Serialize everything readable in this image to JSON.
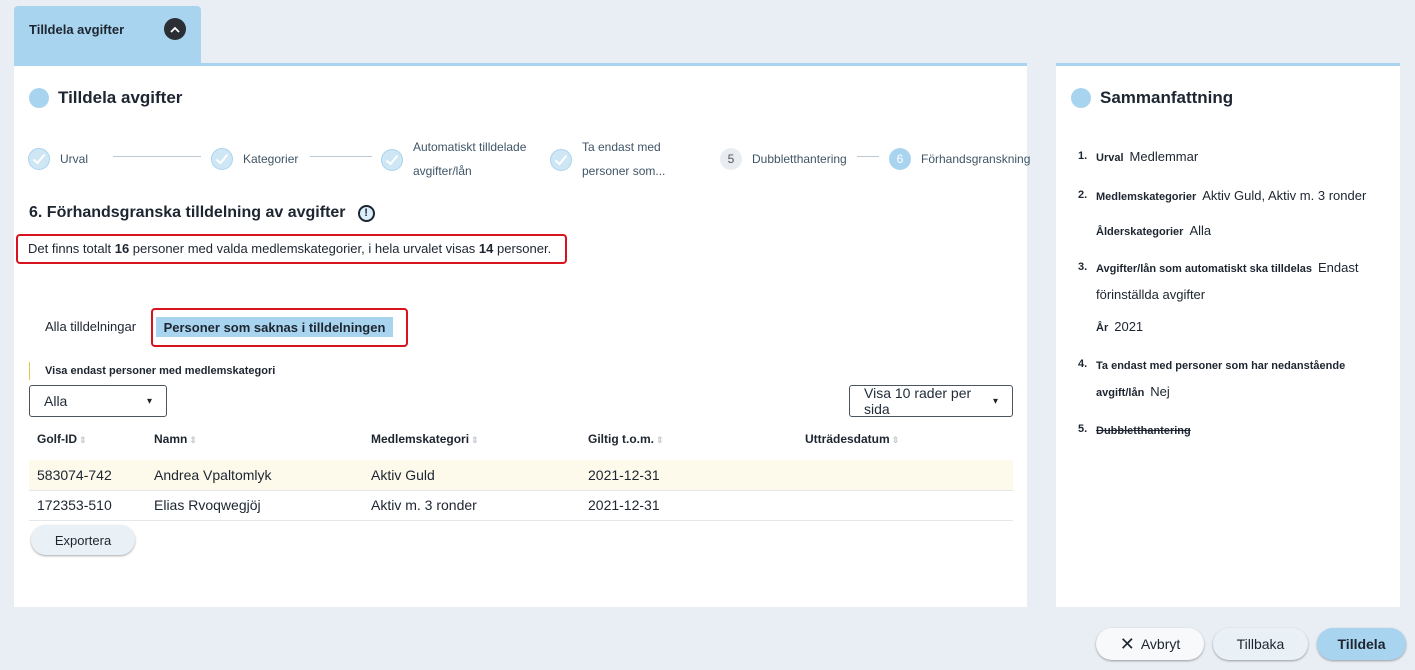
{
  "top_tab": {
    "label": "Tilldela avgifter"
  },
  "main": {
    "title": "Tilldela avgifter",
    "steps": [
      {
        "label": "Urval",
        "state": "done"
      },
      {
        "label": "Kategorier",
        "state": "done"
      },
      {
        "label_line1": "Automatiskt tilldelade",
        "label_line2": "avgifter/lån",
        "state": "done"
      },
      {
        "label_line1": "Ta endast med",
        "label_line2": "personer som...",
        "state": "done"
      },
      {
        "number": "5",
        "label": "Dubbletthantering",
        "state": "pending"
      },
      {
        "number": "6",
        "label": "Förhandsgranskning",
        "state": "active"
      }
    ],
    "section_title": "6. Förhandsgranska tilldelning av avgifter",
    "info_icon": "!",
    "summary": {
      "part1": "Det finns totalt ",
      "total": "16",
      "part2": " personer med valda medlemskategorier, i hela urvalet visas ",
      "shown": "14",
      "part3": " personer."
    },
    "tabs": [
      {
        "label": "Alla tilldelningar",
        "active": false
      },
      {
        "label": "Personer som saknas i tilldelningen",
        "active": true
      }
    ],
    "filter": {
      "label": "Visa endast personer med medlemskategori",
      "value": "Alla"
    },
    "rows_per_page": "Visa 10 rader per sida",
    "table": {
      "headers": [
        "Golf-ID",
        "Namn",
        "Medlemskategori",
        "Giltig t.o.m.",
        "Utträdesdatum"
      ],
      "rows": [
        [
          "583074-742",
          "Andrea Vpaltomlyk",
          "Aktiv Guld",
          "2021-12-31",
          ""
        ],
        [
          "172353-510",
          "Elias Rvoqwegjöj",
          "Aktiv m. 3 ronder",
          "2021-12-31",
          ""
        ]
      ]
    },
    "export_label": "Exportera"
  },
  "side": {
    "title": "Sammanfattning",
    "items": [
      {
        "num": "1.",
        "key": "Urval",
        "value": "Medlemmar"
      },
      {
        "num": "2.",
        "key": "Medlemskategorier",
        "value": "Aktiv Guld, Aktiv m. 3 ronder",
        "sub_key": "Ålderskategorier",
        "sub_value": "Alla"
      },
      {
        "num": "3.",
        "key": "Avgifter/lån som automatiskt ska tilldelas",
        "value": "Endast förinställda avgifter",
        "sub_key": "År",
        "sub_value": "2021"
      },
      {
        "num": "4.",
        "key": "Ta endast med personer som har nedanstående avgift/lån",
        "value": "Nej"
      },
      {
        "num": "5.",
        "key": "Dubbletthantering"
      }
    ]
  },
  "footer": {
    "cancel": "Avbryt",
    "back": "Tillbaka",
    "submit": "Tilldela"
  },
  "colors": {
    "accent": "#a9d4ef",
    "highlight_border": "#d8131f",
    "background": "#e9eef4"
  }
}
